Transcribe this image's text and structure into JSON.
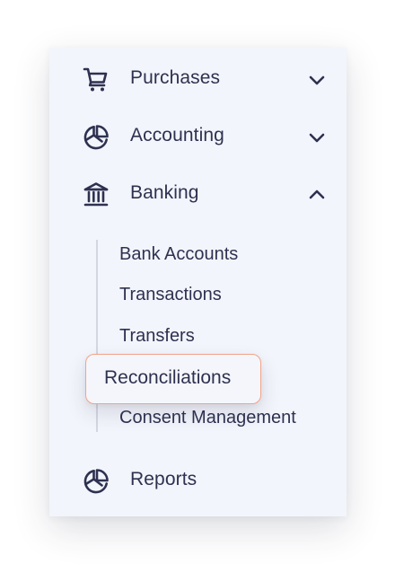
{
  "sidebar": {
    "items": [
      {
        "label": "Purchases",
        "icon": "cart-icon",
        "expanded": false
      },
      {
        "label": "Accounting",
        "icon": "chart-pie-icon",
        "expanded": false
      },
      {
        "label": "Banking",
        "icon": "bank-icon",
        "expanded": true
      },
      {
        "label": "Reports",
        "icon": "chart-pie-icon",
        "expanded": false
      }
    ],
    "banking_submenu": [
      {
        "label": "Bank Accounts"
      },
      {
        "label": "Transactions"
      },
      {
        "label": "Transfers"
      },
      {
        "label": "Reconciliations",
        "active": true
      },
      {
        "label": "Consent Management"
      }
    ]
  },
  "colors": {
    "panel_background": "#f3f5fc",
    "text": "#2e3150",
    "icon": "#2e3150",
    "active_border": "#f2a488"
  }
}
